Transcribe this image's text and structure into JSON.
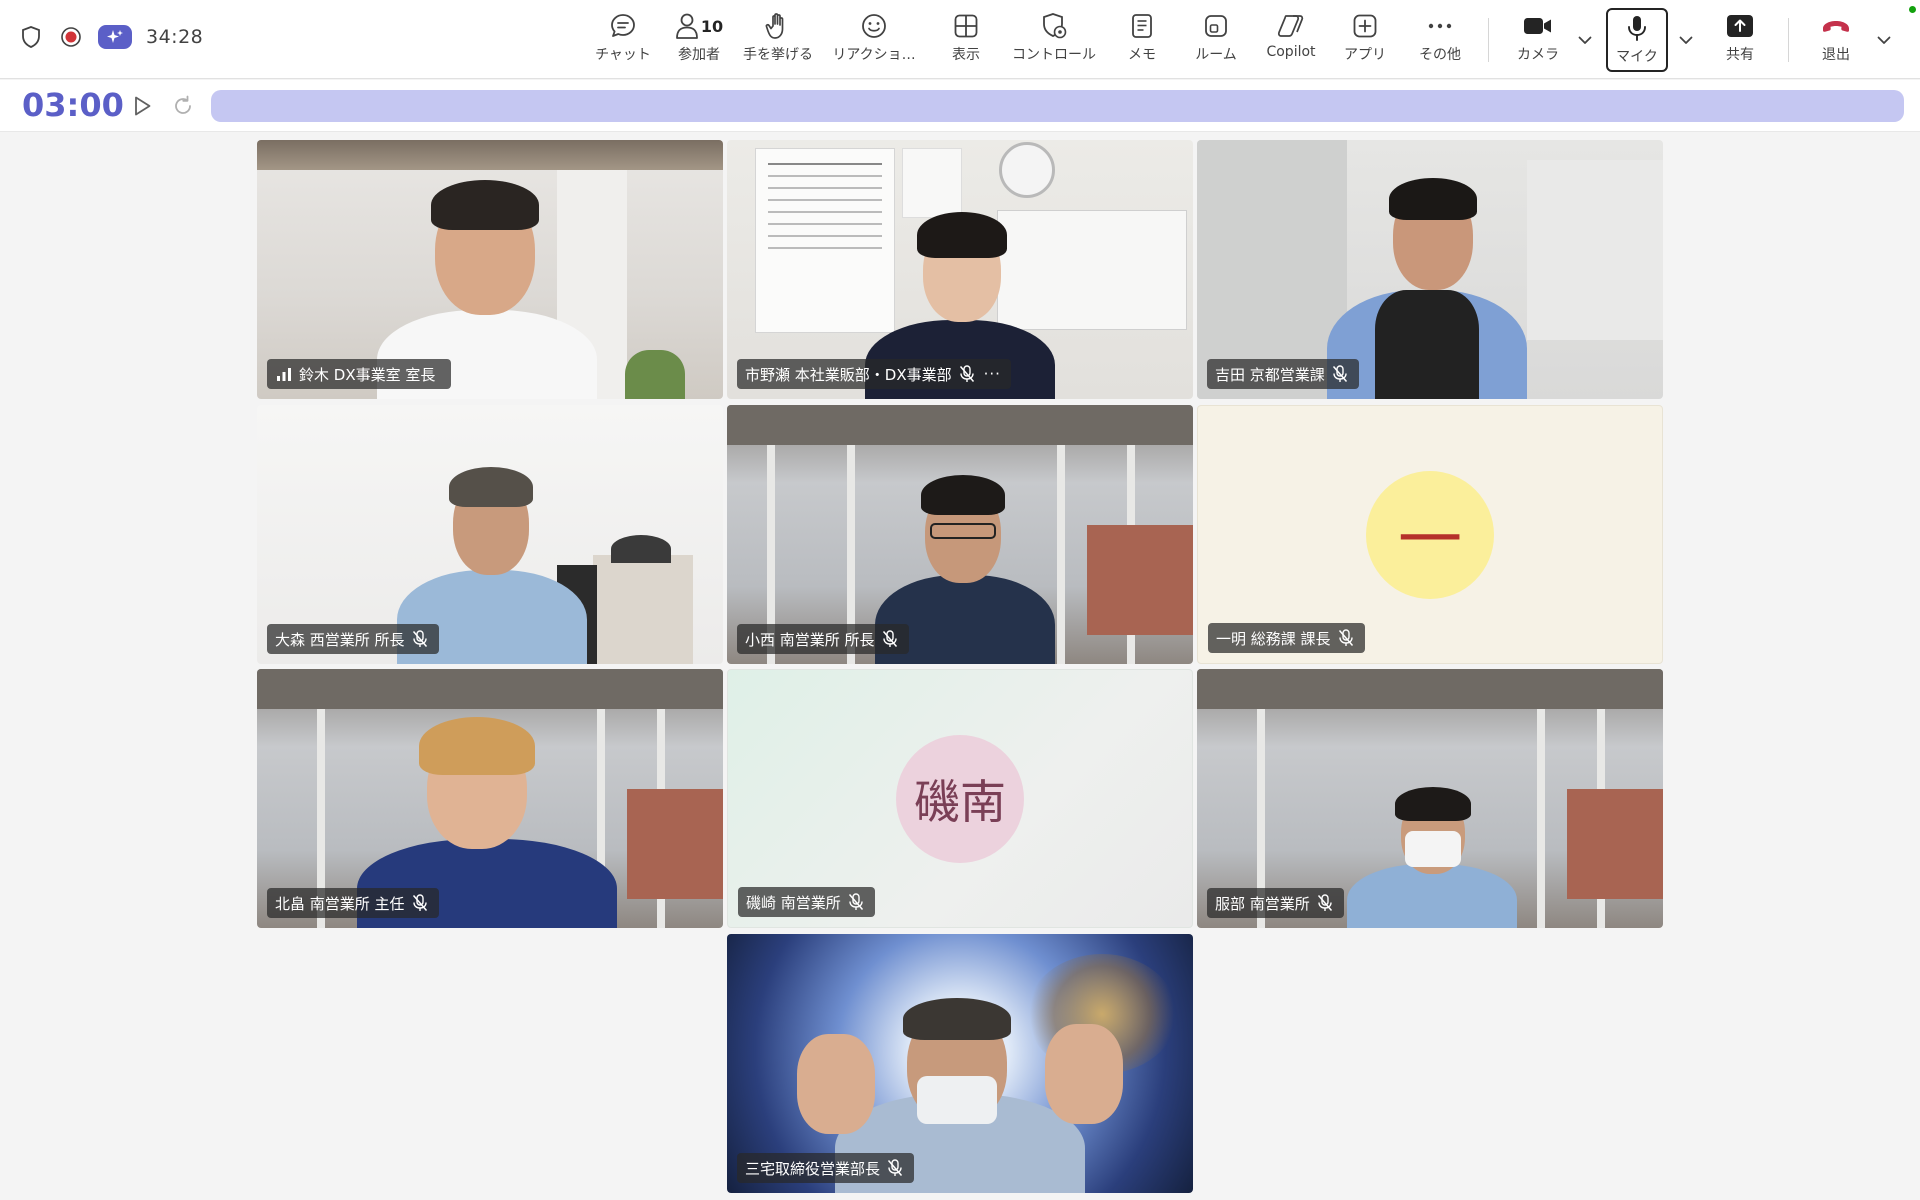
{
  "status": {
    "call_duration": "34:28"
  },
  "toolbar": {
    "chat_label": "チャット",
    "participants_label": "参加者",
    "participants_count": "10",
    "raise_hand_label": "手を挙げる",
    "reactions_label": "リアクショ…",
    "view_label": "表示",
    "controls_label": "コントロール",
    "notes_label": "メモ",
    "rooms_label": "ルーム",
    "copilot_label": "Copilot",
    "apps_label": "アプリ",
    "more_label": "その他",
    "camera_label": "カメラ",
    "mic_label": "マイク",
    "share_label": "共有",
    "leave_label": "退出"
  },
  "timer": {
    "value": "03:00",
    "progress_fraction": 1.0
  },
  "colors": {
    "accent": "#5b5fc7",
    "timer_bar": "#c5c7f2",
    "leave_red": "#c4314b"
  },
  "participants": [
    {
      "name": "鈴木 DX事業室 室長",
      "status_icon": "signal-bars-icon"
    },
    {
      "name": "市野瀬 本社業販部・DX事業部",
      "status_icon": "mic-off-icon"
    },
    {
      "name": "吉田 京都営業課",
      "status_icon": "mic-off-icon"
    },
    {
      "name": "大森 西営業所 所長",
      "status_icon": "mic-off-icon"
    },
    {
      "name": "小西 南営業所 所長",
      "status_icon": "mic-off-icon"
    },
    {
      "name": "一明 総務課 課長",
      "status_icon": "mic-off-icon",
      "avatar_text": "一"
    },
    {
      "name": "北畠 南営業所 主任",
      "status_icon": "mic-off-icon"
    },
    {
      "name": "磯崎 南営業所",
      "status_icon": "mic-off-icon",
      "avatar_text": "磯南"
    },
    {
      "name": "服部 南営業所",
      "status_icon": "mic-off-icon"
    },
    {
      "name": "三宅取締役営業部長",
      "status_icon": "mic-off-icon"
    }
  ]
}
